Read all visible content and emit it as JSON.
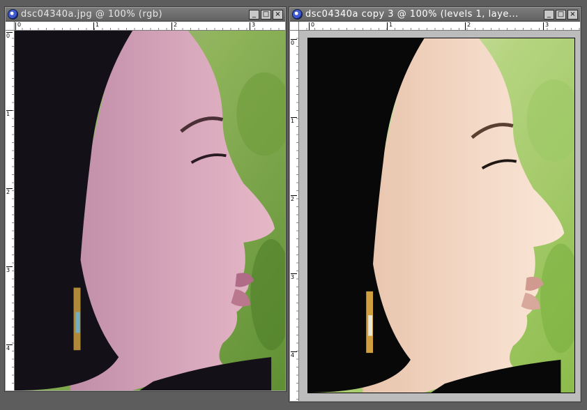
{
  "windows": [
    {
      "title": "dsc04340a.jpg @ 100% (rgb)",
      "ruler_h": [
        "0",
        "1",
        "2",
        "3"
      ],
      "ruler_v": [
        "0",
        "1",
        "2",
        "3",
        "4"
      ],
      "photo": {
        "variant": "original",
        "skin": "#d6a6b8",
        "background": "#7fa84a",
        "hair": "#141018"
      }
    },
    {
      "title": "dsc04340a copy 3 @ 100% (levels 1, laye...",
      "ruler_h": [
        "0",
        "1",
        "2",
        "3"
      ],
      "ruler_v": [
        "0",
        "1",
        "2",
        "3",
        "4"
      ],
      "photo": {
        "variant": "levels-adjusted",
        "skin": "#f2d6c2",
        "background": "#9fc860",
        "hair": "#080808"
      }
    }
  ],
  "window_buttons": {
    "minimize": "_",
    "maximize": "□",
    "close": "×"
  },
  "icons": {
    "app_icon": "photoshop-eye-icon"
  }
}
